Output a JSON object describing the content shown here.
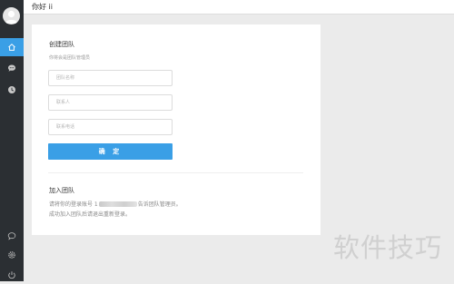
{
  "header": {
    "greeting": "你好 ii"
  },
  "sidebar": {
    "avatar": "user-avatar",
    "nav": [
      {
        "icon": "home-icon",
        "active": true
      },
      {
        "icon": "chat-bubble-icon",
        "active": false
      },
      {
        "icon": "clock-icon",
        "active": false
      }
    ],
    "bottom": [
      {
        "icon": "message-icon"
      },
      {
        "icon": "gear-icon"
      },
      {
        "icon": "power-icon"
      }
    ]
  },
  "create_team": {
    "title": "创建团队",
    "hint": "你将会是团队管理员",
    "team_name_placeholder": "团队名称",
    "contact_placeholder": "联系人",
    "phone_placeholder": "联系电话",
    "confirm_label": "确 定"
  },
  "join_team": {
    "title": "加入团队",
    "line1_prefix": "请将你的登录账号 1",
    "line1_suffix": "告诉团队管理员。",
    "line2": "成功加入团队后请退出重新登录。"
  },
  "watermark": "软件技巧",
  "colors": {
    "accent": "#3a9fe6",
    "sidebar": "#2b2f33",
    "background": "#ebebeb"
  }
}
